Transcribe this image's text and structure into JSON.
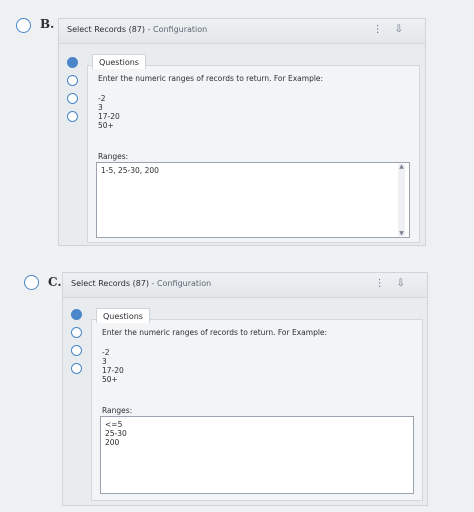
{
  "options": [
    {
      "letter": "B.",
      "title": "Select Records (87)",
      "subtitle": "- Configuration",
      "header_icons": [
        "⋮",
        "⇩"
      ],
      "tab": "Questions",
      "instruction": "Enter the numeric ranges of records to return.  For Example:",
      "examples": [
        "-2",
        "3",
        "17-20",
        "50+"
      ],
      "ranges_label": "Ranges:",
      "ranges_value": "1-5, 25-30, 200"
    },
    {
      "letter": "C.",
      "title": "Select Records (87)",
      "subtitle": "- Configuration",
      "header_icons": [
        "⋮",
        "⇩"
      ],
      "tab": "Questions",
      "instruction": "Enter the numeric ranges of records to return.  For Example:",
      "examples": [
        "-2",
        "3",
        "17-20",
        "50+"
      ],
      "ranges_label": "Ranges:",
      "ranges_value": "<=5\n25-30\n200"
    }
  ]
}
